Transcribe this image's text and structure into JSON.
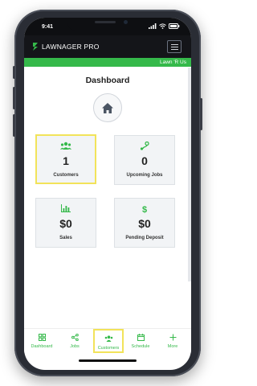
{
  "status": {
    "time": "9:41"
  },
  "app": {
    "name": "LAWNAGER PRO",
    "account": "Lawn 'R Us"
  },
  "page": {
    "title": "Dashboard"
  },
  "cards": [
    {
      "value": "1",
      "label": "Customers",
      "icon": "users-icon"
    },
    {
      "value": "0",
      "label": "Upcoming Jobs",
      "icon": "route-icon"
    },
    {
      "value": "$0",
      "label": "Sales",
      "icon": "bar-chart-icon"
    },
    {
      "value": "$0",
      "label": "Pending Deposit",
      "icon": "dollar-icon"
    }
  ],
  "tabs": [
    {
      "label": "Dashboard",
      "icon": "grid-icon"
    },
    {
      "label": "Jobs",
      "icon": "share-nodes-icon"
    },
    {
      "label": "Customers",
      "icon": "users-icon"
    },
    {
      "label": "Schedule",
      "icon": "calendar-icon"
    },
    {
      "label": "More",
      "icon": "plus-icon"
    }
  ],
  "colors": {
    "accent": "#35b94a",
    "header": "#141519",
    "highlight": "#f2e35a"
  }
}
